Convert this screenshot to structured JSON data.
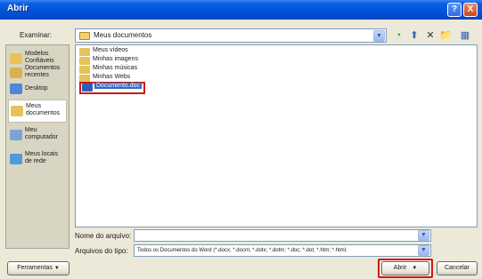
{
  "window": {
    "title": "Abrir",
    "help_label": "?",
    "close_label": "X"
  },
  "top": {
    "look_in_label": "Examinar:",
    "look_in_value": "Meus documentos",
    "dropdown_glyph": "▼",
    "toolbar": {
      "back": "◔",
      "up": "⬆",
      "delete": "✕",
      "new_folder": "📁",
      "views": "▦"
    }
  },
  "places": [
    {
      "label": "Modelos\nConfiáveis",
      "icon": "folder-icon",
      "color": "#e6c35a"
    },
    {
      "label": "Documentos\nrecentes",
      "icon": "recent-documents-icon",
      "color": "#d9b14a"
    },
    {
      "label": "Desktop",
      "icon": "desktop-icon",
      "color": "#4f86d8"
    },
    {
      "label": "Meus\ndocumentos",
      "icon": "my-documents-icon",
      "color": "#e6c35a"
    },
    {
      "label": "Meu\ncomputador",
      "icon": "my-computer-icon",
      "color": "#7aa3d6"
    },
    {
      "label": "Meus locais\nde rede",
      "icon": "network-places-icon",
      "color": "#4f9ad8"
    }
  ],
  "files": [
    {
      "name": "Meus vídeos",
      "icon": "videos-folder-icon",
      "color": "#e6c35a"
    },
    {
      "name": "Minhas imagens",
      "icon": "pictures-folder-icon",
      "color": "#e6c35a"
    },
    {
      "name": "Minhas músicas",
      "icon": "music-folder-icon",
      "color": "#e6c35a"
    },
    {
      "name": "Minhas Webs",
      "icon": "webs-folder-icon",
      "color": "#e6c35a"
    },
    {
      "name": "Documento.doc",
      "icon": "word-document-icon",
      "color": "#2b5fb4",
      "selected": true
    }
  ],
  "bottom": {
    "filename_label": "Nome do arquivo:",
    "filename_value": "",
    "filetype_label": "Arquivos do tipo:",
    "filetype_value": "Todos os Documentos do Word (*.docx; *.docm; *.dotx; *.dotm; *.doc; *.dot; *.htm; *.html; ",
    "tools_button": "Ferramentas",
    "open_button": "Abrir",
    "cancel_button": "Cancelar",
    "button_dropdown_glyph": "▼"
  },
  "colors": {
    "highlight": "#d01818",
    "selection": "#316ac5",
    "titlebar": "#0053d6"
  }
}
